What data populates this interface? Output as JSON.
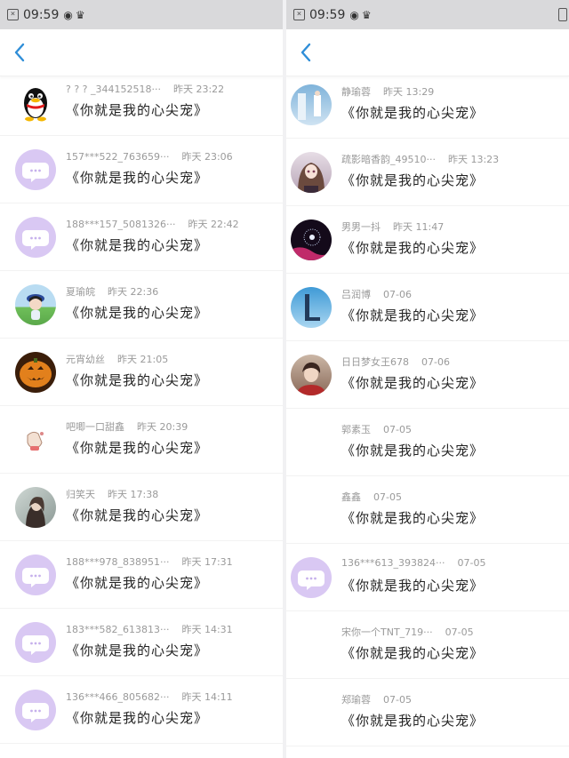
{
  "status_bar": {
    "time": "09:59"
  },
  "colors": {
    "bubble_avatar": "#d9c8f3",
    "accent_back": "#2f8ed8",
    "status_bar_bg": "#d9d9db"
  },
  "left": {
    "rows": [
      {
        "name": "? ? ? _344152518···",
        "time": "昨天 23:22",
        "message": "《你就是我的心尖宠》",
        "avatar": "penguin-icon"
      },
      {
        "name": "157***522_763659···",
        "time": "昨天 23:06",
        "message": "《你就是我的心尖宠》",
        "avatar": "chat-bubble-icon"
      },
      {
        "name": "188***157_5081326···",
        "time": "昨天 22:42",
        "message": "《你就是我的心尖宠》",
        "avatar": "chat-bubble-icon"
      },
      {
        "name": "夏瑜皖",
        "time": "昨天 22:36",
        "message": "《你就是我的心尖宠》",
        "avatar": "cartoon-girl-photo"
      },
      {
        "name": "元宵幼丝",
        "time": "昨天 21:05",
        "message": "《你就是我的心尖宠》",
        "avatar": "pumpkin-photo"
      },
      {
        "name": "吧唧一口甜鑫",
        "time": "昨天 20:39",
        "message": "《你就是我的心尖宠》",
        "avatar": "hand-drawing-photo"
      },
      {
        "name": "归笑天",
        "time": "昨天 17:38",
        "message": "《你就是我的心尖宠》",
        "avatar": "girl-portrait-photo"
      },
      {
        "name": "188***978_838951···",
        "time": "昨天 17:31",
        "message": "《你就是我的心尖宠》",
        "avatar": "chat-bubble-icon"
      },
      {
        "name": "183***582_613813···",
        "time": "昨天 14:31",
        "message": "《你就是我的心尖宠》",
        "avatar": "chat-bubble-icon"
      },
      {
        "name": "136***466_805682···",
        "time": "昨天 14:11",
        "message": "《你就是我的心尖宠》",
        "avatar": "chat-bubble-icon"
      }
    ]
  },
  "right": {
    "rows": [
      {
        "name": "静瑜蓉",
        "time": "昨天 13:29",
        "message": "《你就是我的心尖宠》",
        "avatar": "blue-room-photo"
      },
      {
        "name": "疏影暗香韵_49510···",
        "time": "昨天 13:23",
        "message": "《你就是我的心尖宠》",
        "avatar": "anime-girl-photo"
      },
      {
        "name": "男男一抖",
        "time": "昨天 11:47",
        "message": "《你就是我的心尖宠》",
        "avatar": "dandelion-photo"
      },
      {
        "name": "吕润博",
        "time": "07-06",
        "message": "《你就是我的心尖宠》",
        "avatar": "letter-l-photo"
      },
      {
        "name": "日日梦女王678",
        "time": "07-06",
        "message": "《你就是我的心尖宠》",
        "avatar": "boy-portrait-photo"
      },
      {
        "name": "郭素玉",
        "time": "07-05",
        "message": "《你就是我的心尖宠》",
        "avatar": "none"
      },
      {
        "name": "鑫鑫",
        "time": "07-05",
        "message": "《你就是我的心尖宠》",
        "avatar": "none"
      },
      {
        "name": "136***613_393824···",
        "time": "07-05",
        "message": "《你就是我的心尖宠》",
        "avatar": "chat-bubble-icon"
      },
      {
        "name": "宋你一个TNT_719···",
        "time": "07-05",
        "message": "《你就是我的心尖宠》",
        "avatar": "none"
      },
      {
        "name": "郑瑜蓉",
        "time": "07-05",
        "message": "《你就是我的心尖宠》",
        "avatar": "none"
      }
    ]
  }
}
